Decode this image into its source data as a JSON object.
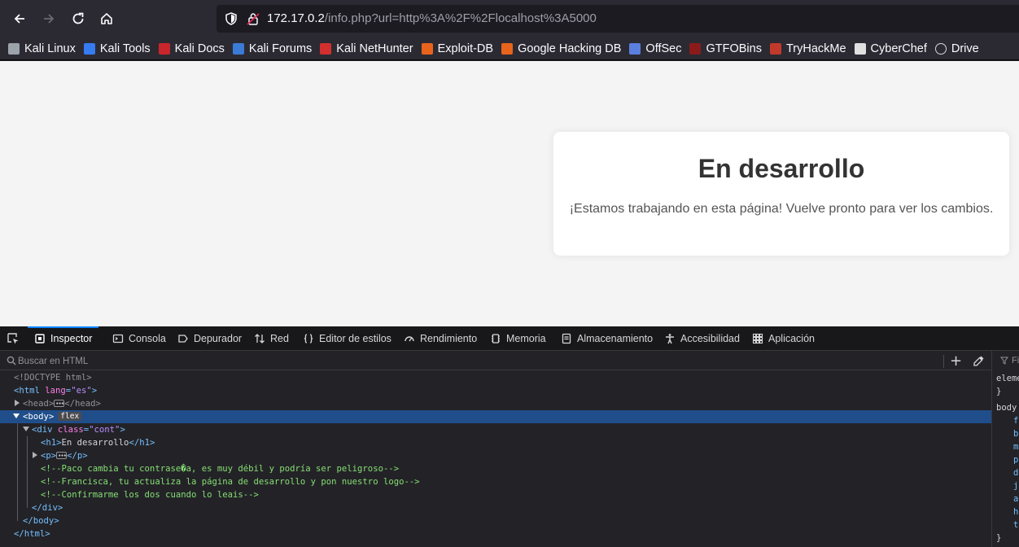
{
  "browser": {
    "url_host": "172.17.0.2",
    "url_path": "/info.php?url=http%3A%2F%2Flocalhost%3A5000",
    "bookmarks": [
      {
        "label": "Kali Linux",
        "icon": "kali-dragon-icon",
        "color": "#9ba3ab"
      },
      {
        "label": "Kali Tools",
        "icon": "kali-tools-icon",
        "color": "#367bf0"
      },
      {
        "label": "Kali Docs",
        "icon": "kali-docs-icon",
        "color": "#c9252c"
      },
      {
        "label": "Kali Forums",
        "icon": "kali-forums-icon",
        "color": "#3a7bd5"
      },
      {
        "label": "Kali NetHunter",
        "icon": "nethunter-icon",
        "color": "#d32f2f"
      },
      {
        "label": "Exploit-DB",
        "icon": "exploit-db-icon",
        "color": "#e8631c"
      },
      {
        "label": "Google Hacking DB",
        "icon": "ghdb-icon",
        "color": "#e8631c"
      },
      {
        "label": "OffSec",
        "icon": "offsec-icon",
        "color": "#5b7fde"
      },
      {
        "label": "GTFOBins",
        "icon": "gtfobins-icon",
        "color": "#8b1a1a"
      },
      {
        "label": "TryHackMe",
        "icon": "tryhackme-icon",
        "color": "#c0392b"
      },
      {
        "label": "CyberChef",
        "icon": "cyberchef-icon",
        "color": "#e0e0e0"
      },
      {
        "label": "Drive",
        "icon": "globe-icon",
        "color": "#d7d7db"
      }
    ]
  },
  "page": {
    "heading": "En desarrollo",
    "message": "¡Estamos trabajando en esta página! Vuelve pronto para ver los cambios."
  },
  "devtools": {
    "tabs": [
      {
        "label": "Inspector",
        "icon": "inspector-icon",
        "active": true
      },
      {
        "label": "Consola",
        "icon": "console-icon"
      },
      {
        "label": "Depurador",
        "icon": "debugger-icon"
      },
      {
        "label": "Red",
        "icon": "network-icon"
      },
      {
        "label": "Editor de estilos",
        "icon": "style-editor-icon"
      },
      {
        "label": "Rendimiento",
        "icon": "performance-icon"
      },
      {
        "label": "Memoria",
        "icon": "memory-icon"
      },
      {
        "label": "Almacenamiento",
        "icon": "storage-icon"
      },
      {
        "label": "Accesibilidad",
        "icon": "accessibility-icon"
      },
      {
        "label": "Aplicación",
        "icon": "application-icon"
      }
    ],
    "search_placeholder": "Buscar en HTML",
    "tree": {
      "doctype": "<!DOCTYPE html>",
      "html_open": "<html ",
      "html_attr": "lang",
      "html_val": "\"es\"",
      "head_open": "<head>",
      "head_close": "</head>",
      "body_open": "<body>",
      "body_badge": "flex",
      "div_open": "<div ",
      "div_attr": "class",
      "div_val": "\"cont\"",
      "h1_open": "<h1>",
      "h1_text": "En desarrollo",
      "h1_close": "</h1>",
      "p_open": "<p>",
      "p_close": "</p>",
      "comment1": "<!--Paco cambia tu contrase�a, es muy débil y podría ser peligroso-->",
      "comment2": "<!--Francisca, tu actualiza la página de desarrollo y pon nuestro logo-->",
      "comment3": "<!--Confirmarme los dos cuando lo leais-->",
      "div_close": "</div>",
      "body_close": "</body>",
      "html_close": "</html>"
    },
    "rules": {
      "filter_label": "Fi",
      "lines": [
        "eleme",
        "}",
        "body",
        "fo",
        "ba",
        "ma",
        "pa",
        "di",
        "ju",
        "a",
        "he",
        "te",
        "}"
      ]
    }
  },
  "colors": {
    "accent": "#0a84ff",
    "selection": "#204e8a",
    "comment": "#86de74",
    "tag": "#75bfff",
    "attr": "#ff7de9",
    "value": "#b98eff"
  }
}
